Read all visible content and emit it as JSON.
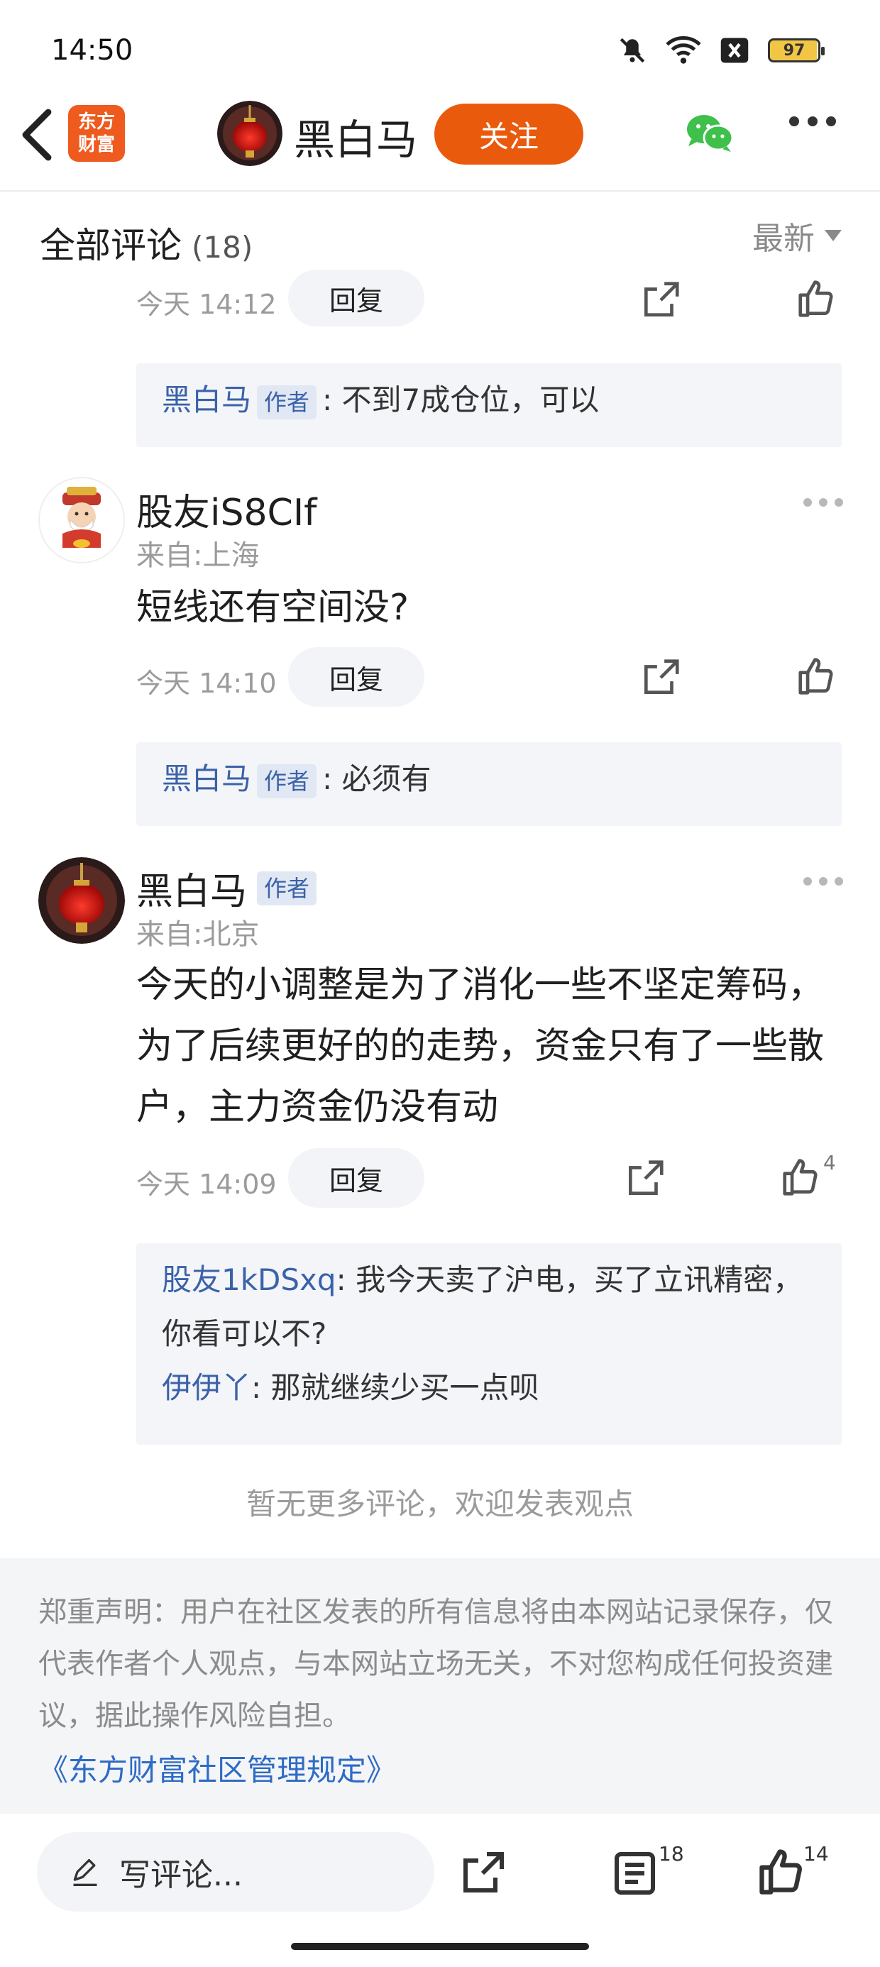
{
  "status_bar": {
    "time": "14:50",
    "battery": "97",
    "icons": [
      "mute-icon",
      "wifi-icon",
      "sim-off-icon",
      "battery-icon"
    ]
  },
  "header": {
    "logo_line1": "东方",
    "logo_line2": "财富",
    "name": "黑白马",
    "follow_label": "关注"
  },
  "comments_header": {
    "title": "全部评论",
    "count": "(18)",
    "sort": "最新"
  },
  "comments": [
    {
      "time": "今天 14:12",
      "reply_label": "回复",
      "sub_replies": [
        {
          "name": "黑白马",
          "tag": "作者",
          "text": ": 不到7成仓位，可以"
        }
      ]
    },
    {
      "user": "股友iS8CIf",
      "location": "来自:上海",
      "text": "短线还有空间没?",
      "time": "今天 14:10",
      "reply_label": "回复",
      "sub_replies": [
        {
          "name": "黑白马",
          "tag": "作者",
          "text": ": 必须有"
        }
      ]
    },
    {
      "user": "黑白马",
      "user_tag": "作者",
      "location": "来自:北京",
      "text": "今天的小调整是为了消化一些不坚定筹码，为了后续更好的的走势，资金只有了一些散户，主力资金仍没有动",
      "time": "今天 14:09",
      "reply_label": "回复",
      "likes": "4",
      "sub_replies": [
        {
          "name": "股友1kDSxq",
          "text": ": 我今天卖了沪电，买了立讯精密，你看可以不?"
        },
        {
          "name": "伊伊丫",
          "text": ": 那就继续少买一点呗"
        }
      ]
    }
  ],
  "no_more": "暂无更多评论，欢迎发表观点",
  "disclaimer": {
    "text": "郑重声明：用户在社区发表的所有信息将由本网站记录保存，仅代表作者个人观点，与本网站立场无关，不对您构成任何投资建议，据此操作风险自担。",
    "link": "《东方财富社区管理规定》"
  },
  "bottom_bar": {
    "write_placeholder": "写评论...",
    "comment_count": "18",
    "like_count": "14"
  },
  "colors": {
    "accent": "#ea5a0d",
    "link_blue": "#3b62a8",
    "muted": "#9b9b9b"
  }
}
